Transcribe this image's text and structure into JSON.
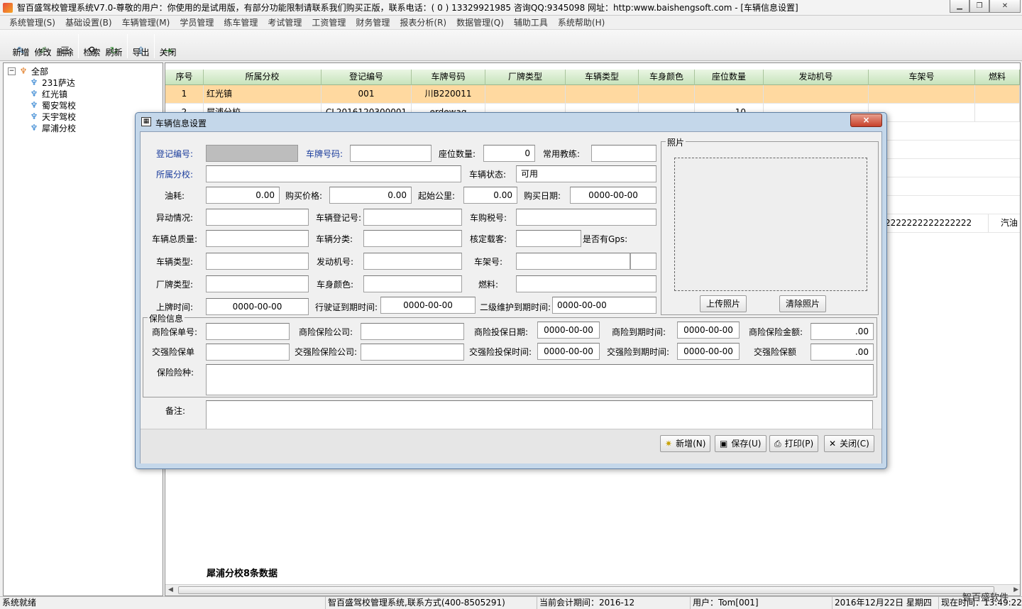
{
  "window": {
    "title": "智百盛驾校管理系统V7.0-尊敬的用户：你使用的是试用版，有部分功能限制请联系我们购买正版，联系电话：( 0 ) 13329921985 咨询QQ:9345098 网址：http:www.baishengsoft.com - [车辆信息设置]",
    "min_icon": "minimize-icon",
    "restore_icon": "restore-icon",
    "close_icon": "close-icon"
  },
  "menu": [
    "系统管理(S)",
    "基础设置(B)",
    "车辆管理(M)",
    "学员管理",
    "练车管理",
    "考试管理",
    "工资管理",
    "财务管理",
    "报表分析(R)",
    "数据管理(Q)",
    "辅助工具",
    "系统帮助(H)"
  ],
  "toolbar": {
    "add": "新增",
    "edit": "修改",
    "delete": "删除",
    "search": "检索",
    "refresh": "刷新",
    "export": "导出",
    "close": "关闭"
  },
  "tree": {
    "root": "全部",
    "children": [
      "231萨达",
      "红光镇",
      "蜀安驾校",
      "天宇驾校",
      "犀浦分校"
    ]
  },
  "grid": {
    "columns": [
      "序号",
      "所属分校",
      "登记编号",
      "车牌号码",
      "厂牌类型",
      "车辆类型",
      "车身颜色",
      "座位数量",
      "发动机号",
      "车架号",
      "燃料"
    ],
    "rows": [
      [
        "1",
        "红光镇",
        "001",
        "川B220011",
        "",
        "",
        "",
        "",
        "",
        "",
        ""
      ],
      [
        "2",
        "犀浦分校",
        "CL2016120300001",
        "erdewaq",
        "",
        "",
        "",
        "10",
        "",
        "",
        ""
      ]
    ],
    "partial_row": {
      "frame": "2222222222222222",
      "fuel": "汽油"
    },
    "footer": "犀浦分校8条数据"
  },
  "status": {
    "ready": "系统就绪",
    "company": "智百盛驾校管理系统,联系方式(400-8505291)",
    "period": "当前会计期间：2016-12",
    "user": "用户：Tom[001]",
    "date": "2016年12月22日 星期四",
    "time": "现在时间：13:49:22",
    "brand": "智百盛软件"
  },
  "dialog": {
    "title": "车辆信息设置",
    "labels": {
      "reg_no": "登记编号:",
      "plate": "车牌号码:",
      "seats": "座位数量:",
      "coach": "常用教练:",
      "branch": "所属分校:",
      "status": "车辆状态:",
      "fuel_cons": "油耗:",
      "price": "购买价格:",
      "start_km": "起始公里:",
      "buy_date": "购买日期:",
      "change": "异动情况:",
      "veh_reg_no": "车辆登记号:",
      "tax_no": "车购税号:",
      "total_mass": "车辆总质量:",
      "category": "车辆分类:",
      "capacity": "核定载客:",
      "gps": "是否有Gps:",
      "veh_type": "车辆类型:",
      "engine": "发动机号:",
      "frame": "车架号:",
      "brand": "厂牌类型:",
      "color": "车身颜色:",
      "fuel": "燃料:",
      "plate_date": "上牌时间:",
      "license_exp": "行驶证到期时间:",
      "maint_exp": "二级维护到期时间:"
    },
    "values": {
      "seats": "0",
      "status": "可用",
      "fuel_cons": "0.00",
      "price": "0.00",
      "start_km": "0.00",
      "buy_date": "0000-00-00",
      "plate_date": "0000-00-00",
      "license_exp": "0000-00-00",
      "maint_exp": "0000-00-00"
    },
    "photo": {
      "legend": "照片",
      "upload": "上传照片",
      "clear": "清除照片"
    },
    "insurance": {
      "legend": "保险信息",
      "labels": {
        "com_no": "商险保单号:",
        "com_company": "商险保险公司:",
        "com_date": "商险投保日期:",
        "com_exp": "商险到期时间:",
        "com_amount": "商险保险金额:",
        "cmp_no": "交强险保单",
        "cmp_company": "交强险保险公司:",
        "cmp_date": "交强险投保时间:",
        "cmp_exp": "交强险到期时间:",
        "cmp_amount": "交强险保额",
        "types": "保险险种:"
      },
      "values": {
        "com_date": "0000-00-00",
        "com_exp": "0000-00-00",
        "com_amount": ".00",
        "cmp_date": "0000-00-00",
        "cmp_exp": "0000-00-00",
        "cmp_amount": ".00"
      }
    },
    "remark": "备注:",
    "buttons": {
      "add": "新增(N)",
      "save": "保存(U)",
      "print": "打印(P)",
      "close": "关闭(C)"
    },
    "close_x": "×"
  }
}
